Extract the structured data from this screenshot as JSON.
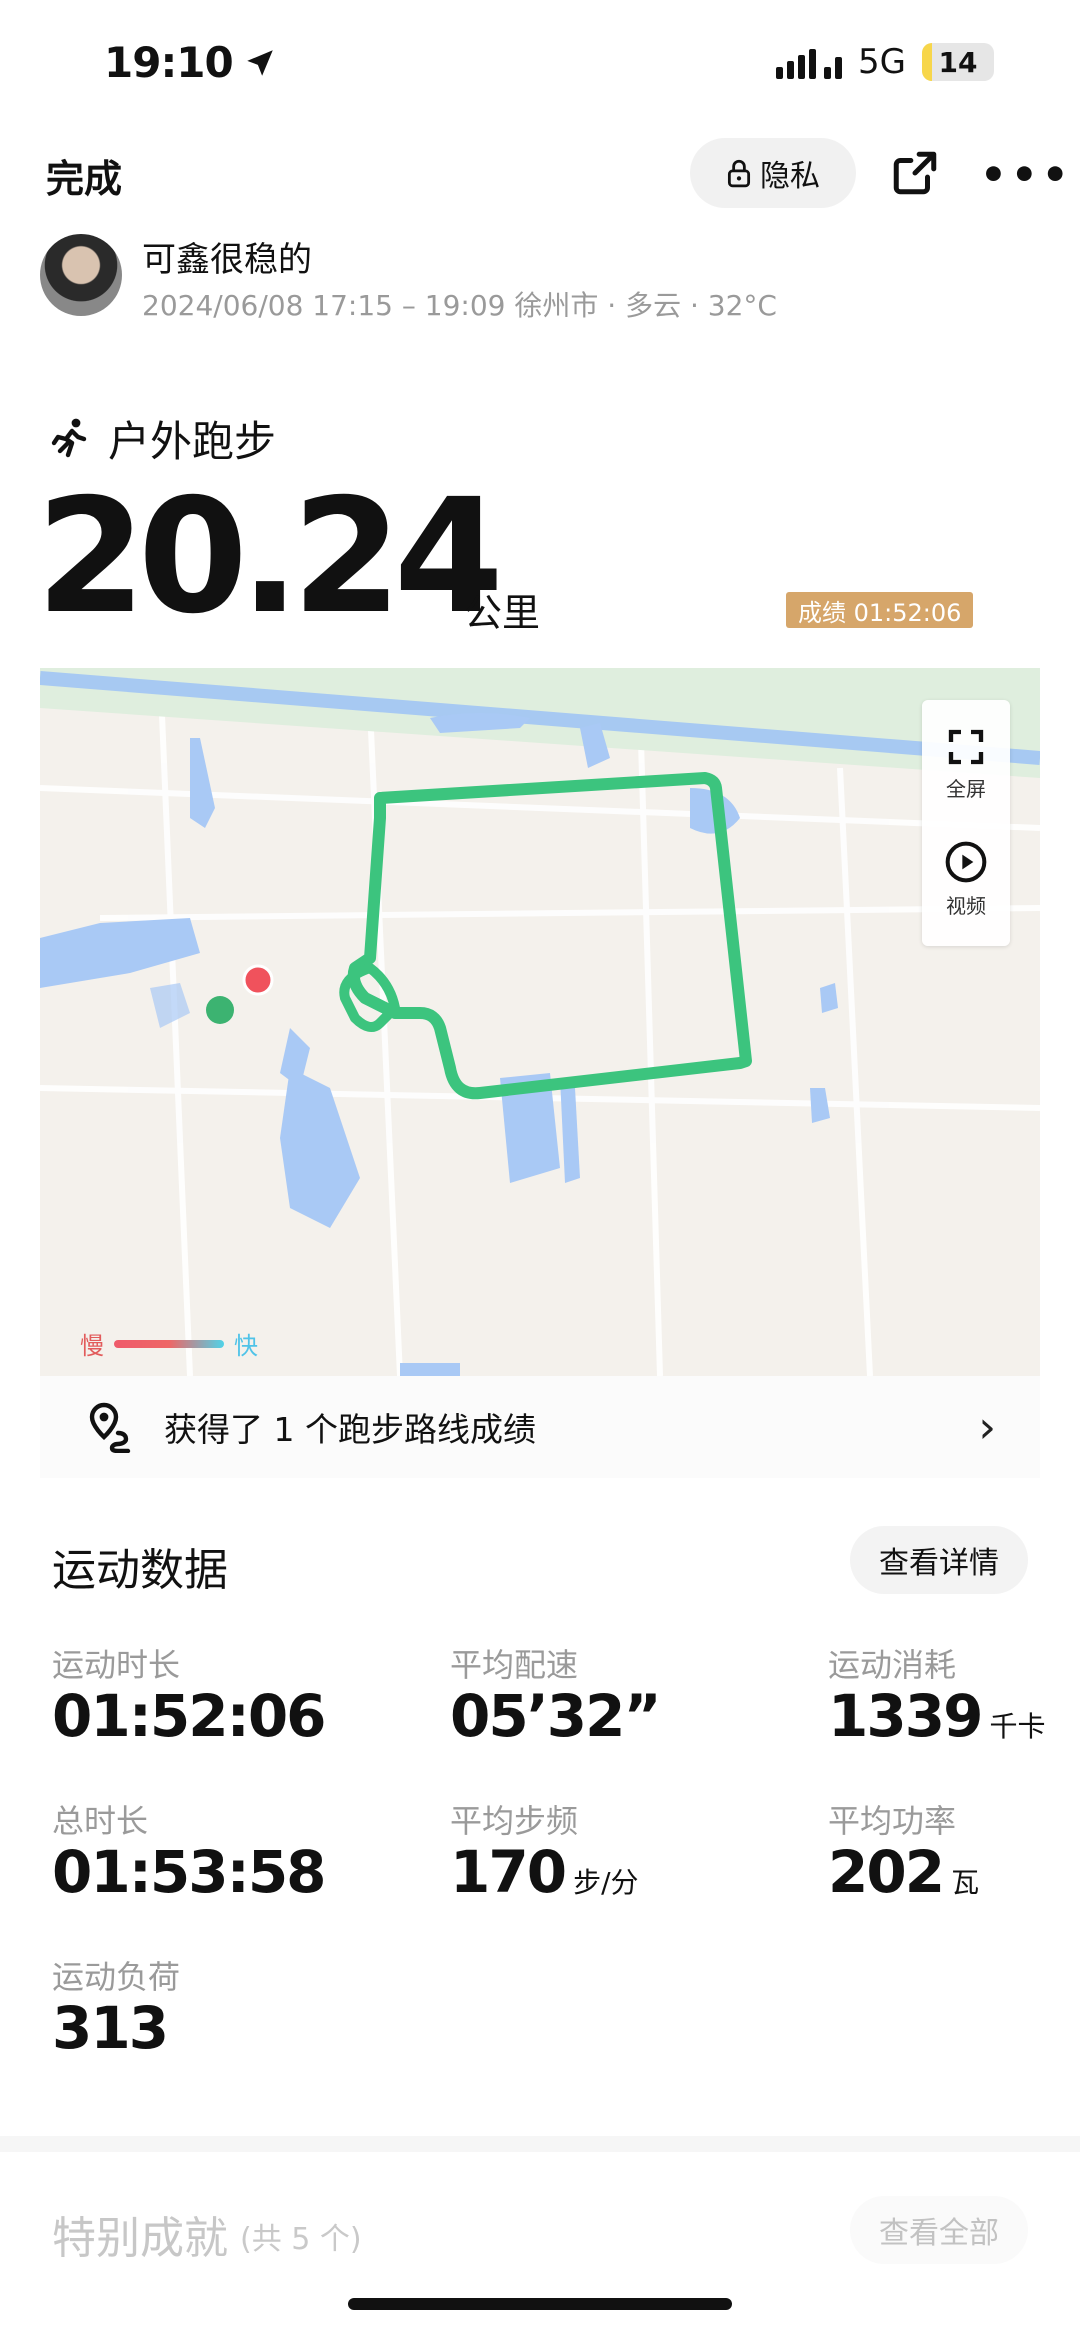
{
  "status_bar": {
    "time": "19:10",
    "network": "5G",
    "battery": "14",
    "battery_level": 0.14
  },
  "header": {
    "done_label": "完成",
    "privacy_label": "隐私"
  },
  "user": {
    "name": "可鑫很稳的",
    "meta": "2024/06/08 17:15 – 19:09 徐州市 · 多云 · 32°C"
  },
  "activity": {
    "type": "户外跑步",
    "distance": "20.24",
    "unit": "公里",
    "score": "成绩 01:52:06"
  },
  "map": {
    "fullscreen_label": "全屏",
    "video_label": "视频",
    "legend_slow": "慢",
    "legend_fast": "快",
    "route_color": "#3cc47e",
    "start_color": "#3cb371",
    "end_color": "#f0525c"
  },
  "route_banner": {
    "text": "获得了 1 个跑步路线成绩"
  },
  "sport_data": {
    "title": "运动数据",
    "detail_label": "查看详情",
    "stats": [
      {
        "label": "运动时长",
        "value": "01:52:06",
        "unit": ""
      },
      {
        "label": "平均配速",
        "value": "05’32”",
        "unit": ""
      },
      {
        "label": "运动消耗",
        "value": "1339",
        "unit": "千卡"
      },
      {
        "label": "总时长",
        "value": "01:53:58",
        "unit": ""
      },
      {
        "label": "平均步频",
        "value": "170",
        "unit": "步/分"
      },
      {
        "label": "平均功率",
        "value": "202",
        "unit": "瓦"
      },
      {
        "label": "运动负荷",
        "value": "313",
        "unit": ""
      }
    ]
  },
  "achievements": {
    "title": "特别成就",
    "count": "(共 5 个)",
    "all_label": "查看全部"
  }
}
